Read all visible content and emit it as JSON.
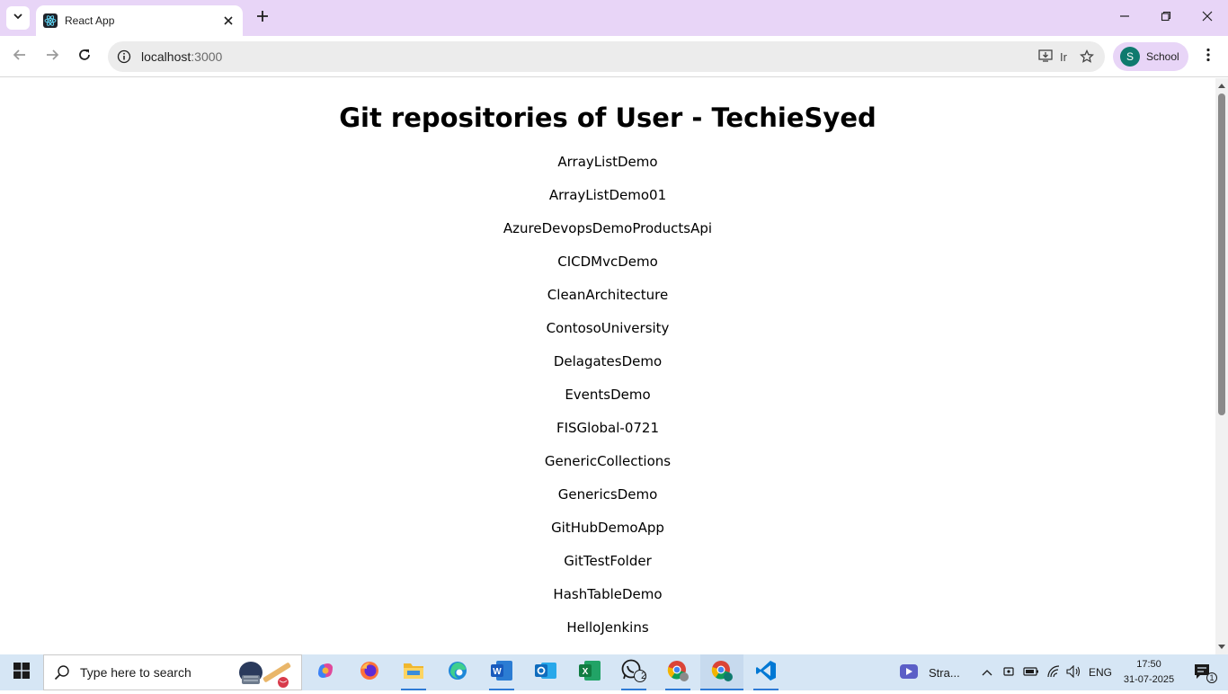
{
  "browser": {
    "tab": {
      "title": "React App"
    },
    "address_bar": {
      "url_host": "localhost",
      "url_port": ":3000"
    },
    "install_hint": "Ir",
    "profile": {
      "initial": "S",
      "name": "School"
    }
  },
  "page": {
    "title": "Git repositories of User - TechieSyed",
    "repositories": [
      "ArrayListDemo",
      "ArrayListDemo01",
      "AzureDevopsDemoProductsApi",
      "CICDMvcDemo",
      "CleanArchitecture",
      "ContosoUniversity",
      "DelagatesDemo",
      "EventsDemo",
      "FISGlobal-0721",
      "GenericCollections",
      "GenericsDemo",
      "GitHubDemoApp",
      "GitTestFolder",
      "HashTableDemo",
      "HelloJenkins"
    ]
  },
  "taskbar": {
    "search_placeholder": "Type here to search",
    "whatsapp_badge": "2",
    "stream_label": "Stra...",
    "language": "ENG",
    "time": "17:50",
    "date": "31-07-2025",
    "notifications_count": "1"
  },
  "colors": {
    "titlebar": "#e8d5f7",
    "taskbar": "#d6e6f5",
    "accent": "#2f7bd6"
  }
}
